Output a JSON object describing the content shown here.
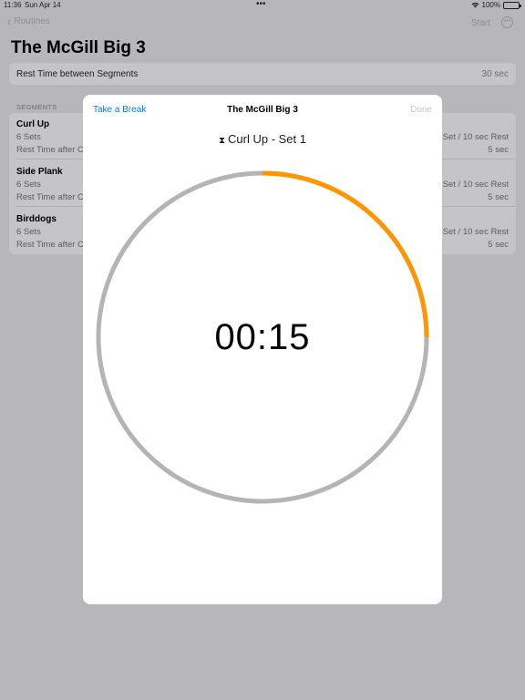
{
  "status_bar": {
    "time": "11:36",
    "date": "Sun Apr 14",
    "dots": "•••",
    "battery": "100%"
  },
  "nav": {
    "back_label": "Routines",
    "start_label": "Start",
    "more_icon": "ellipsis-circle-icon"
  },
  "page": {
    "title": "The McGill Big 3",
    "rest_between_label": "Rest Time between Segments",
    "rest_between_value": "30 sec",
    "segments_header": "SEGMENTS"
  },
  "segments": [
    {
      "name": "Curl Up",
      "sets": "6 Sets",
      "rest_after": "Rest Time after C",
      "detail": "Set / 10 sec Rest",
      "rest_value": "5 sec"
    },
    {
      "name": "Side Plank",
      "sets": "6 Sets",
      "rest_after": "Rest Time after C",
      "detail": "Set / 10 sec Rest",
      "rest_value": "5 sec"
    },
    {
      "name": "Birddogs",
      "sets": "6 Sets",
      "rest_after": "Rest Time after C",
      "detail": "Set / 10 sec Rest",
      "rest_value": "5 sec"
    }
  ],
  "modal": {
    "break_label": "Take a Break",
    "title": "The McGill Big 3",
    "done_label": "Done",
    "current_segment": "Curl Up - Set 1",
    "hourglass_icon": "hourglass-icon",
    "timer": "00:15",
    "progress_fraction": 0.25,
    "colors": {
      "progress": "#ff9500",
      "track": "#b4b4b4",
      "accent": "#007aff"
    }
  }
}
